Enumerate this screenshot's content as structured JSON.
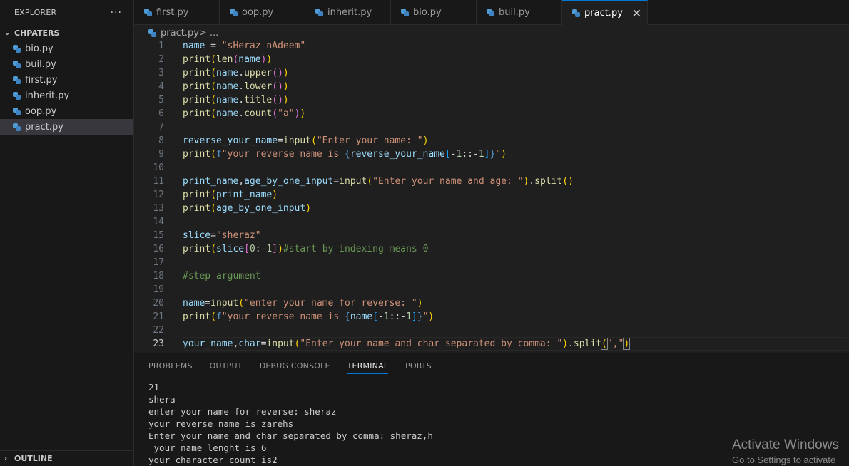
{
  "sidebar": {
    "title": "EXPLORER",
    "more": "···",
    "folder": "CHPATERS",
    "files": [
      "bio.py",
      "buil.py",
      "first.py",
      "inherit.py",
      "oop.py",
      "pract.py"
    ],
    "active_file": "pract.py",
    "outline": "OUTLINE"
  },
  "tabs": [
    "first.py",
    "oop.py",
    "inherit.py",
    "bio.py",
    "buil.py",
    "pract.py"
  ],
  "active_tab": "pract.py",
  "close_glyph": "✕",
  "breadcrumb": {
    "file": "pract.py",
    "sep": " > ..."
  },
  "line_numbers": [
    "1",
    "2",
    "3",
    "4",
    "5",
    "6",
    "7",
    "8",
    "9",
    "10",
    "11",
    "12",
    "13",
    "14",
    "15",
    "16",
    "17",
    "18",
    "19",
    "20",
    "21",
    "22",
    "23"
  ],
  "current_line": "23",
  "panel": {
    "tabs": [
      "PROBLEMS",
      "OUTPUT",
      "DEBUG CONSOLE",
      "TERMINAL",
      "PORTS"
    ],
    "active_tab": "TERMINAL"
  },
  "terminal_lines": [
    "21",
    "shera",
    "enter your name for reverse: sheraz",
    "your reverse name is zarehs",
    "Enter your name and char separated by comma: sheraz,h",
    " your name lenght is 6",
    "your character count is2"
  ],
  "watermark": {
    "line1": "Activate Windows",
    "line2": "Go to Settings to activate Windows."
  },
  "colors": {
    "accent": "#0078d4",
    "background": "#1f1f1f",
    "sidebar": "#181818"
  }
}
